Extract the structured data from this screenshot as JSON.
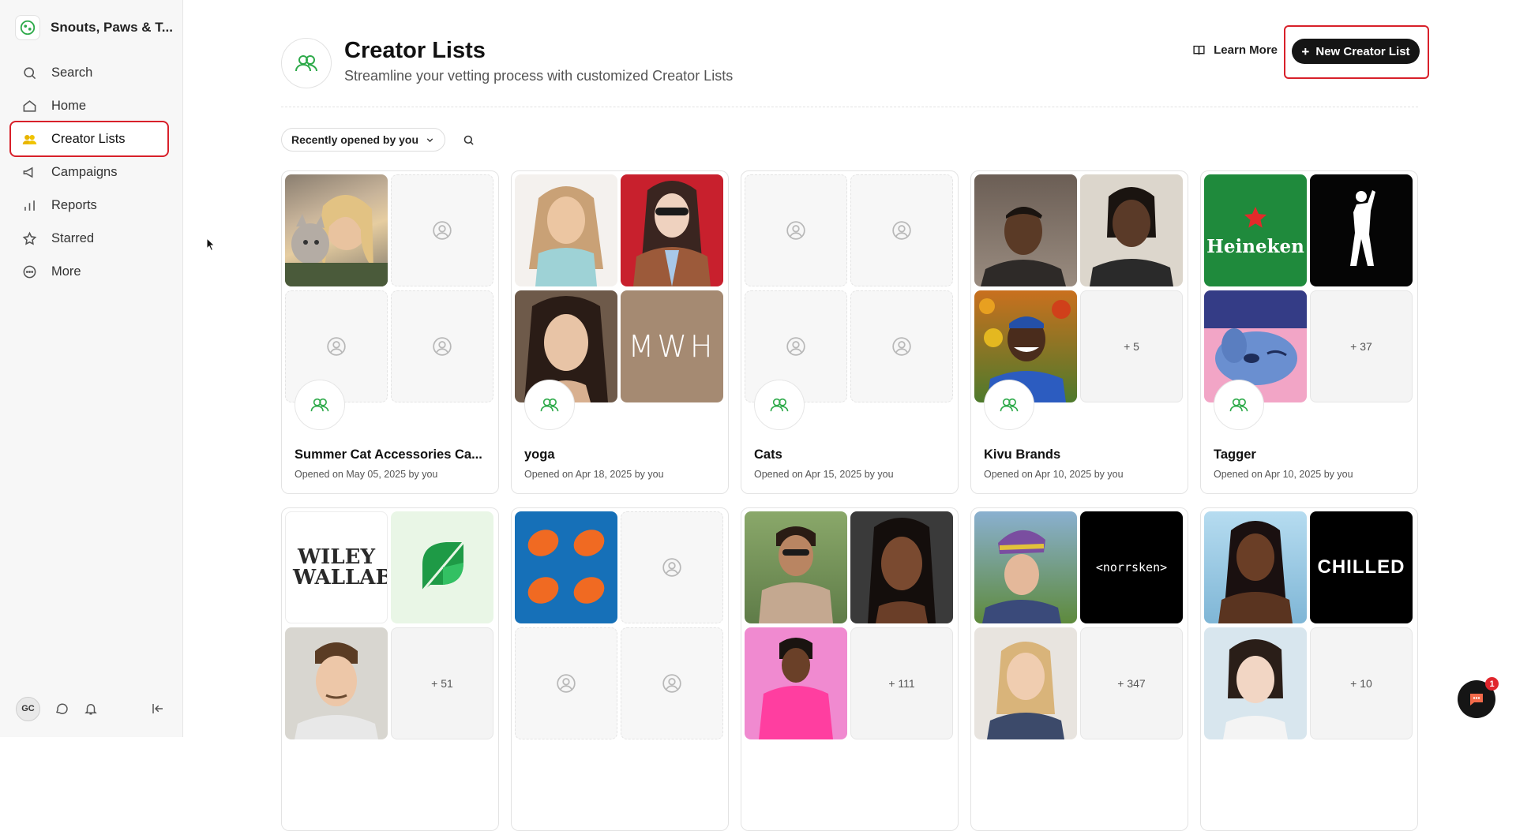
{
  "brand": {
    "name": "Snouts, Paws & T..."
  },
  "nav": [
    {
      "label": "Search",
      "icon": "search-icon"
    },
    {
      "label": "Home",
      "icon": "home-icon"
    },
    {
      "label": "Creator Lists",
      "icon": "users-icon",
      "active": true
    },
    {
      "label": "Campaigns",
      "icon": "megaphone-icon"
    },
    {
      "label": "Reports",
      "icon": "bar-chart-icon"
    },
    {
      "label": "Starred",
      "icon": "star-icon"
    },
    {
      "label": "More",
      "icon": "more-icon"
    }
  ],
  "user": {
    "initials": "GC"
  },
  "header": {
    "title": "Creator Lists",
    "subtitle": "Streamline your vetting process with customized Creator Lists",
    "learn_more": "Learn More",
    "new_button": "New Creator List"
  },
  "filter": {
    "sort_label": "Recently opened by you"
  },
  "cards": [
    {
      "title": "Summer Cat Accessories Ca...",
      "subtitle": "Opened on May 05, 2025 by you"
    },
    {
      "title": "yoga",
      "subtitle": "Opened on Apr 18, 2025 by you"
    },
    {
      "title": "Cats",
      "subtitle": "Opened on Apr 15, 2025 by you"
    },
    {
      "title": "Kivu Brands",
      "subtitle": "Opened on Apr 10, 2025 by you"
    },
    {
      "title": "Tagger",
      "subtitle": "Opened on Apr 10, 2025 by you"
    }
  ],
  "more_counts": {
    "kivu": "+ 5",
    "tagger": "+ 37",
    "row2_1": "+ 51",
    "row2_3": "+ 111",
    "row2_4": "+ 347",
    "row2_5": "+ 10"
  },
  "logos": {
    "mwh": "MWH",
    "heineken": "Heineken",
    "wiley": "WILEY WALLABY",
    "norrsken": "<norrsken>",
    "chilled": "CHILLED"
  },
  "chat": {
    "badge": "1"
  },
  "colors": {
    "accent_green": "#2eaa4a",
    "primary_button": "#151515",
    "highlight_red": "#d8202a"
  }
}
